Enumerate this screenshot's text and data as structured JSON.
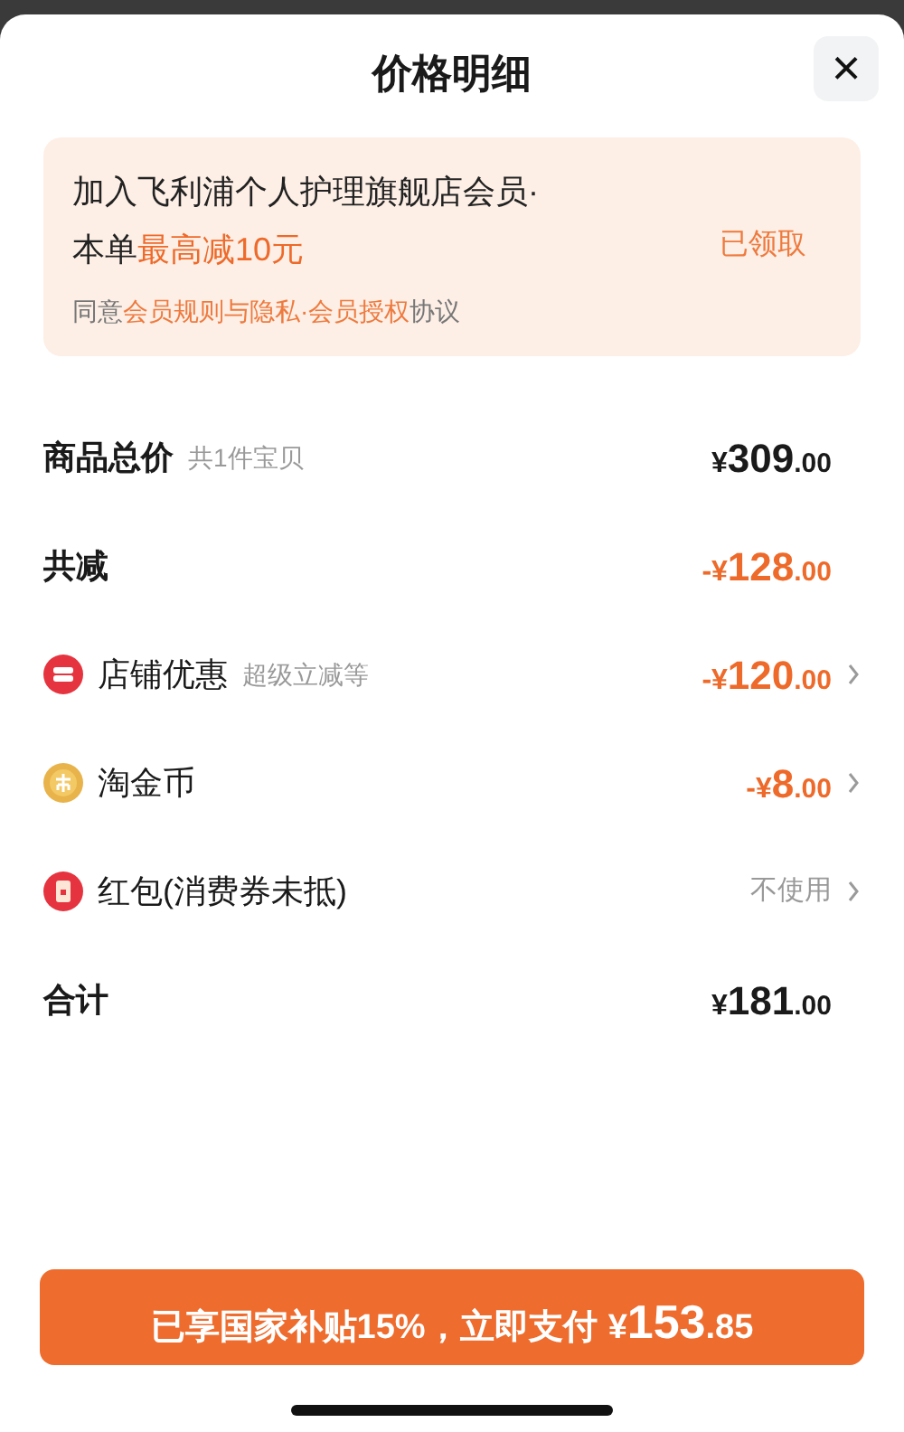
{
  "sheet": {
    "title": "价格明细",
    "close": "×"
  },
  "member_card": {
    "headline": [
      [
        {
          "text": "加入飞利浦个人护理旗舰店会员·",
          "highlight": false
        }
      ],
      [
        {
          "text": "本单",
          "highlight": false
        },
        {
          "text": "最高减10元",
          "highlight": true
        }
      ]
    ],
    "status": "已领取",
    "agreement": [
      {
        "text": "同意",
        "link": false
      },
      {
        "text": "会员规则与隐私·会员授权",
        "link": true
      },
      {
        "text": "协议",
        "link": false
      }
    ]
  },
  "rows": [
    {
      "kind": "sum",
      "label": "商品总价",
      "sublabel": "共1件宝贝",
      "price": {
        "sign": "¥",
        "main": "309",
        "cents": ".00"
      }
    },
    {
      "kind": "reduction",
      "label": "共减",
      "price": {
        "sign": "-¥",
        "main": "128",
        "cents": ".00"
      }
    },
    {
      "kind": "discount",
      "label": "店铺优惠",
      "sublabel": "超级立减等",
      "price": {
        "sign": "-¥",
        "main": "120",
        "cents": ".00"
      }
    },
    {
      "kind": "discount",
      "label": "淘金币",
      "price": {
        "sign": "-¥",
        "main": "8",
        "cents": ".00"
      }
    },
    {
      "kind": "option",
      "label": "红包(消费券未抵)",
      "value": "不使用"
    },
    {
      "kind": "sum",
      "label": "合计",
      "price": {
        "sign": "¥",
        "main": "181",
        "cents": ".00"
      }
    }
  ],
  "pay_button": {
    "text": "已享国家补贴15%，立即支付",
    "sign": "¥",
    "main": "153",
    "cents": ".85"
  }
}
